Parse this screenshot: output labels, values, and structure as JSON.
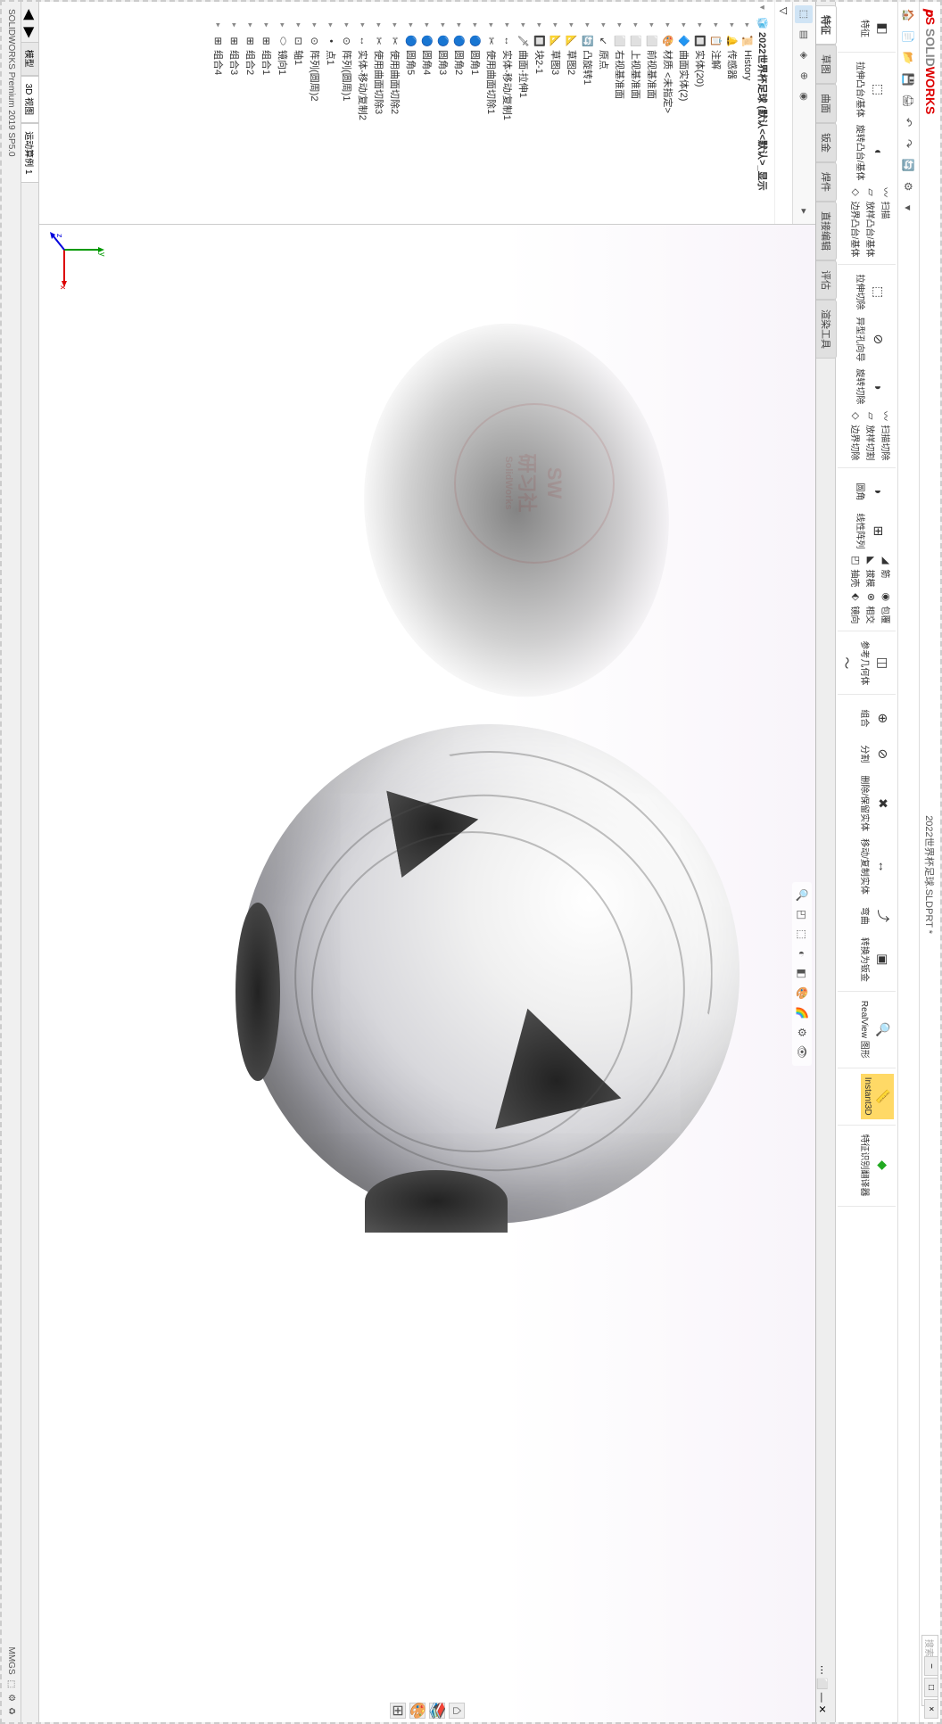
{
  "app": {
    "logo_solid": "SOLID",
    "logo_works": "WORKS",
    "title": "2022世界杯足球.SLDPRT *",
    "search_placeholder": "搜索命令"
  },
  "ribbon": {
    "feature_label": "特征",
    "extrude_boss": "拉伸凸台/基体",
    "revolve_boss": "旋转凸台/基体",
    "sweep": "扫描",
    "loft": "放样凸台/基体",
    "boundary": "边界凸台/基体",
    "extrude_cut": "拉伸切除",
    "hole_wizard": "异型孔向导",
    "revolve_cut": "旋转切除",
    "sweep_cut": "扫描切除",
    "loft_cut": "放样切割",
    "boundary_cut": "边界切除",
    "fillet": "圆角",
    "linear_pattern": "线性阵列",
    "rib": "筋",
    "draft": "拔模",
    "shell": "抽壳",
    "wrap": "包覆",
    "intersect": "相交",
    "mirror": "镜向",
    "ref_geom": "参考几何体",
    "curves": "曲线",
    "combine": "组合",
    "split": "分割",
    "delete_keep": "删除/保留实体",
    "move_copy": "移动/复制实体",
    "bend": "弯曲",
    "sheetmetal_convert": "转换为钣金",
    "realview": "RealView 图形",
    "instant3d": "Instant3D",
    "feature_recognize": "特征识别翻译器"
  },
  "tabs": [
    "草图",
    "曲面",
    "钣金",
    "焊件",
    "直接编辑",
    "评估",
    "渲染工具"
  ],
  "active_tab": "特征",
  "tree": {
    "root": "2022世界杯足球 (默认<<默认>_显示",
    "items": [
      {
        "icon": "📜",
        "label": "History"
      },
      {
        "icon": "🔔",
        "label": "传感器"
      },
      {
        "icon": "📋",
        "label": "注解"
      },
      {
        "icon": "🔲",
        "label": "实体(20)"
      },
      {
        "icon": "🔷",
        "label": "曲面实体(2)"
      },
      {
        "icon": "🎨",
        "label": "材质 <未指定>"
      },
      {
        "icon": "⬜",
        "label": "前视基准面"
      },
      {
        "icon": "⬜",
        "label": "上视基准面"
      },
      {
        "icon": "⬜",
        "label": "右视基准面"
      },
      {
        "icon": "↙",
        "label": "原点"
      },
      {
        "icon": "🔄",
        "label": "凸旋转1"
      },
      {
        "icon": "📐",
        "label": "草图2"
      },
      {
        "icon": "📐",
        "label": "草图3"
      },
      {
        "icon": "🔲",
        "label": "块2-1"
      },
      {
        "icon": "🗡",
        "label": "曲面-拉伸1"
      },
      {
        "icon": "↔",
        "label": "实体-移动/复制1"
      },
      {
        "icon": "✂",
        "label": "使用曲面切除1"
      },
      {
        "icon": "🔵",
        "label": "圆角1"
      },
      {
        "icon": "🔵",
        "label": "圆角2"
      },
      {
        "icon": "🔵",
        "label": "圆角3"
      },
      {
        "icon": "🔵",
        "label": "圆角4"
      },
      {
        "icon": "🔵",
        "label": "圆角5"
      },
      {
        "icon": "✂",
        "label": "使用曲面切除2"
      },
      {
        "icon": "✂",
        "label": "使用曲面切除3"
      },
      {
        "icon": "↔",
        "label": "实体-移动/复制2"
      },
      {
        "icon": "⊙",
        "label": "阵列(圆周)1"
      },
      {
        "icon": "•",
        "label": "点1"
      },
      {
        "icon": "⊙",
        "label": "阵列(圆周)2"
      },
      {
        "icon": "⊡",
        "label": "轴1"
      },
      {
        "icon": "⬭",
        "label": "镜向1"
      },
      {
        "icon": "⊞",
        "label": "组合1"
      },
      {
        "icon": "⊞",
        "label": "组合2"
      },
      {
        "icon": "⊞",
        "label": "组合3"
      },
      {
        "icon": "⊞",
        "label": "组合4"
      }
    ]
  },
  "bottom_tabs": [
    "模型",
    "3D 视图",
    "运动算例 1"
  ],
  "status": {
    "version": "SOLIDWORKS Premium 2019 SP5.0",
    "units": "MMGS"
  },
  "triad": {
    "x": "x",
    "y": "y",
    "z": "z"
  },
  "watermark": {
    "line1": "SW",
    "line2": "研习社",
    "line3": "SolidWorks"
  }
}
